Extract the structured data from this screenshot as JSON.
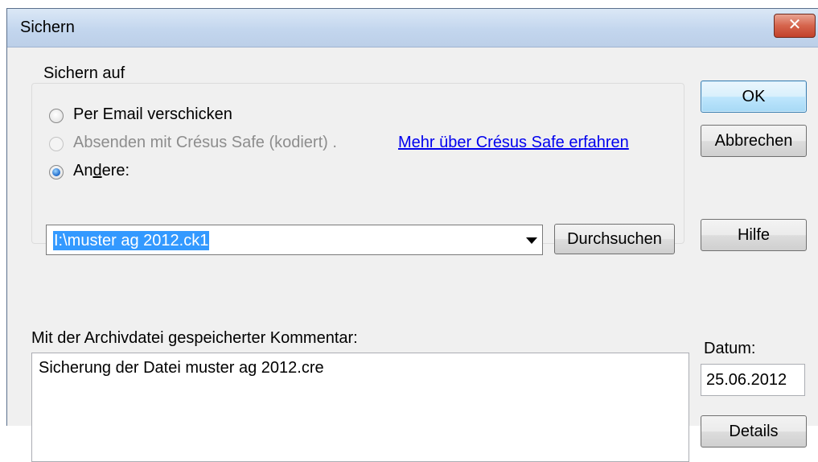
{
  "dialog": {
    "title": "Sichern",
    "close_label": "✕"
  },
  "group": {
    "label": "Sichern auf",
    "options": [
      {
        "label": "Per Email verschicken",
        "checked": false,
        "disabled": false
      },
      {
        "label": "Absenden mit Crésus Safe (kodiert) .",
        "checked": false,
        "disabled": true
      },
      {
        "label_prefix": "An",
        "label_mnemonic": "d",
        "label_suffix": "ere:",
        "checked": true,
        "disabled": false
      }
    ],
    "link": "Mehr über Crésus Safe erfahren",
    "path_value": "I:\\muster ag 2012.ck1",
    "browse_label": "Durchsuchen"
  },
  "buttons": {
    "ok": "OK",
    "cancel": "Abbrechen",
    "help": "Hilfe",
    "details": "Details"
  },
  "comment": {
    "label": "Mit der Archivdatei gespeicherter Kommentar:",
    "value": "Sicherung der Datei muster ag 2012.cre"
  },
  "date": {
    "label": "Datum:",
    "value": "25.06.2012"
  }
}
